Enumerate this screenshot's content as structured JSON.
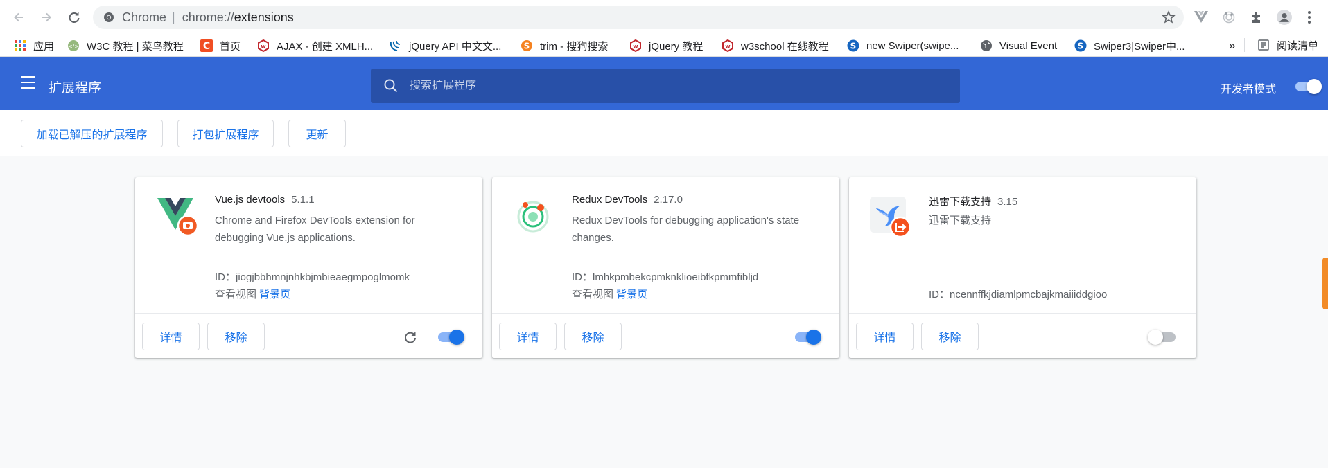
{
  "browser": {
    "omnibox": {
      "label": "Chrome",
      "separator": "|",
      "scheme": "chrome://",
      "path": "extensions"
    },
    "icons": [
      "back-icon",
      "forward-icon",
      "reload-icon",
      "chrome-site-icon",
      "star-icon",
      "vue-ext-icon",
      "redux-ext-icon",
      "puzzle-icon",
      "profile-icon",
      "more-vert-icon"
    ]
  },
  "bookmarks": {
    "items": [
      {
        "label": "应用",
        "icon": "apps-grid-icon"
      },
      {
        "label": "W3C 教程 | 菜鸟教程",
        "icon": "runoob-icon"
      },
      {
        "label": "首页",
        "icon": "c-icon"
      },
      {
        "label": "AJAX - 创建 XMLH...",
        "icon": "w3school-icon"
      },
      {
        "label": "jQuery API 中文文...",
        "icon": "jquery-icon"
      },
      {
        "label": "trim - 搜狗搜索",
        "icon": "sogou-icon"
      },
      {
        "label": "jQuery 教程",
        "icon": "w3school-icon"
      },
      {
        "label": "w3school 在线教程",
        "icon": "w3school-icon"
      },
      {
        "label": "new Swiper(swipe...",
        "icon": "swiper-icon"
      },
      {
        "label": "Visual Event",
        "icon": "globe-icon"
      },
      {
        "label": "Swiper3|Swiper中...",
        "icon": "swiper-icon"
      }
    ],
    "overflow": "»",
    "reading_list": "阅读清单"
  },
  "header": {
    "title": "扩展程序",
    "search_placeholder": "搜索扩展程序",
    "dev_mode_label": "开发者模式",
    "dev_mode_on": true
  },
  "toolbar": {
    "load_unpacked": "加载已解压的扩展程序",
    "pack": "打包扩展程序",
    "update": "更新"
  },
  "extensions": [
    {
      "name": "Vue.js devtools",
      "version": "5.1.1",
      "description": "Chrome and Firefox DevTools extension for debugging Vue.js applications.",
      "id_label": "ID：",
      "id": "jiogjbbhmnjnhkbjmbieaegmpoglmomk",
      "views_label": "查看视图",
      "views_link": "背景页",
      "details": "详情",
      "remove": "移除",
      "enabled": true
    },
    {
      "name": "Redux DevTools",
      "version": "2.17.0",
      "description": "Redux DevTools for debugging application's state changes.",
      "id_label": "ID：",
      "id": "lmhkpmbekcpmknklioeibfkpmmfibljd",
      "views_label": "查看视图",
      "views_link": "背景页",
      "details": "详情",
      "remove": "移除",
      "enabled": true
    },
    {
      "name": "迅雷下载支持",
      "version": "3.15",
      "description": "迅雷下载支持",
      "id_label": "ID：",
      "id": "ncennffkjdiamlpmcbajkmaiiiddgioo",
      "details": "详情",
      "remove": "移除",
      "enabled": false
    }
  ],
  "colors": {
    "header_bg": "#3367d6",
    "search_bg": "#2850a8",
    "link": "#1a73e8",
    "page_bg": "#f8f9fa"
  }
}
